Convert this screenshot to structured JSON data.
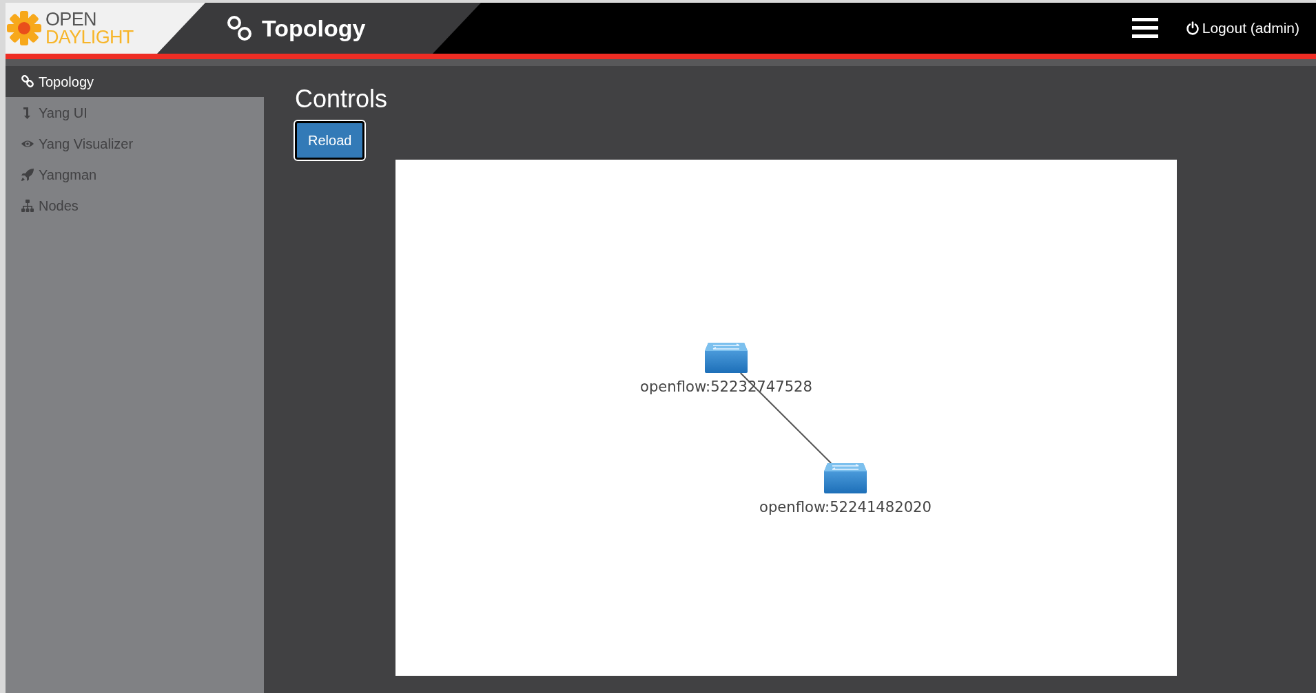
{
  "header": {
    "logo": {
      "line_1": "OPEN",
      "line_2": "DAYLIGHT"
    },
    "title": "Topology",
    "logout": "Logout (admin)"
  },
  "sidebar": {
    "items": [
      {
        "label": "Topology",
        "kind": "link",
        "selected": true
      },
      {
        "label": "Yang UI",
        "kind": "arrow",
        "selected": false
      },
      {
        "label": "Yang Visualizer",
        "kind": "eye",
        "selected": false
      },
      {
        "label": "Yangman",
        "kind": "rocket",
        "selected": false
      },
      {
        "label": "Nodes",
        "kind": "sitemap",
        "selected": false
      }
    ]
  },
  "main": {
    "title": "Controls",
    "reload_button": "Reload",
    "topology": {
      "nodes": [
        {
          "label": "openflow:52232747528"
        },
        {
          "label": "openflow:52241482020"
        }
      ],
      "links": [
        {
          "kind": "line"
        }
      ]
    }
  }
}
